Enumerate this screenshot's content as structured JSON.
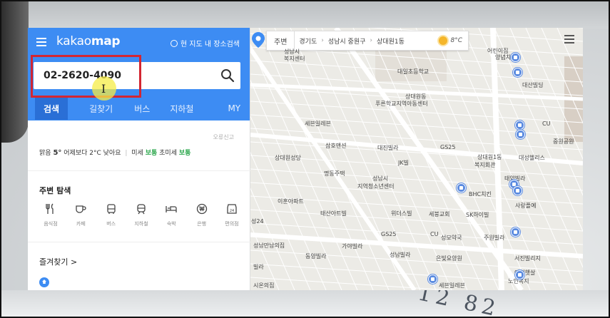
{
  "app": {
    "logo_light": "kakao",
    "logo_bold": "map",
    "local_search_label": "현 지도 내 장소검색"
  },
  "search": {
    "value": "02-2620-4090",
    "icon": "search-icon"
  },
  "tabs": [
    {
      "label": "검색",
      "active": true
    },
    {
      "label": "길찾기"
    },
    {
      "label": "버스"
    },
    {
      "label": "지하철"
    },
    {
      "label": "MY"
    }
  ],
  "report_label": "오류신고",
  "weather": {
    "condition": "맑음",
    "temp": "5°",
    "compare": "어제보다 2°C 낮아요",
    "fine_dust_label": "미세",
    "fine_dust_value": "보통",
    "ultra_dust_label": "초미세",
    "ultra_dust_value": "보통"
  },
  "nearby": {
    "title": "주변 탐색",
    "categories": [
      {
        "label": "음식점",
        "icon": "fork-icon"
      },
      {
        "label": "카페",
        "icon": "cup-icon"
      },
      {
        "label": "버스",
        "icon": "bus-icon"
      },
      {
        "label": "지하철",
        "icon": "subway-icon"
      },
      {
        "label": "숙박",
        "icon": "bed-icon"
      },
      {
        "label": "은행",
        "icon": "won-icon"
      },
      {
        "label": "편의점",
        "icon": "store-24-icon"
      }
    ]
  },
  "favorites": {
    "title": "즐겨찾기 >"
  },
  "map": {
    "nearby_label": "주변",
    "breadcrumb": [
      "경기도",
      "성남시 중원구",
      "상대원1동"
    ],
    "temp": "8°C",
    "labels": [
      "성남시",
      "복지센터",
      "대일초등학교",
      "어린이집",
      "양념치킨",
      "대산빌딩",
      "상대원동",
      "푸른학교지역아동센터",
      "세븐일레븐",
      "CU",
      "중원공원",
      "삼호맨션",
      "대진빌라",
      "GS25",
      "상대원성당",
      "JK빌",
      "상대원1동",
      "복지회관",
      "대성헬리스",
      "명동주택",
      "태양빌라",
      "성남시",
      "지역청소년센터",
      "BHC치킨",
      "이훈아파트",
      "태산아트빌",
      "위더스빌",
      "세붕교회",
      "SK하이빌",
      "사랑플예",
      "GS25",
      "CU",
      "성모약국",
      "주원빌라",
      "성남만남의집",
      "가야빌라",
      "동양빌라",
      "성남빌라",
      "은빛요양원",
      "서진빌리지",
      "아침햇살",
      "노인복지",
      "세븐일레븐",
      "시온의집",
      "성24",
      "빌라"
    ]
  }
}
